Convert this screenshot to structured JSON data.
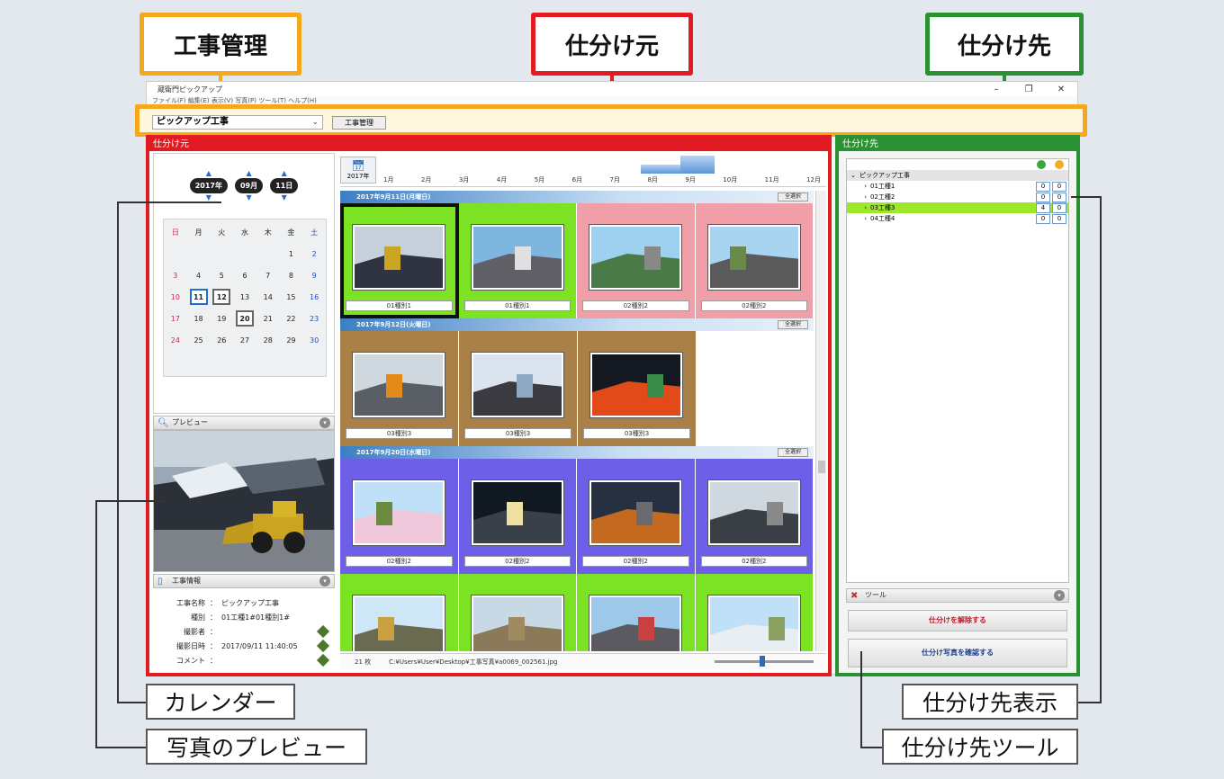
{
  "callouts": {
    "project": "工事管理",
    "source": "仕分け元",
    "dest": "仕分け先",
    "calendar": "カレンダー",
    "preview": "写真のプレビュー",
    "dest_display": "仕分け先表示",
    "dest_tools": "仕分け先ツール"
  },
  "colors": {
    "source": "#e21b23",
    "dest": "#2a9132",
    "project": "#f6a81d"
  },
  "window": {
    "title": "蔵衛門ピックアップ",
    "menu": "ファイル(F)  編集(E)  表示(V)  写真(P)  ツール(T)  ヘルプ(H)"
  },
  "project_bar": {
    "selected": "ピックアップ工事",
    "button": "工事管理"
  },
  "source_panel": {
    "title": "仕分け元"
  },
  "calendar": {
    "year": "2017年",
    "month": "09月",
    "day": "11日",
    "weekdays": [
      "日",
      "月",
      "火",
      "水",
      "木",
      "金",
      "土"
    ],
    "weeks": [
      [
        "",
        "",
        "",
        "",
        "",
        "1",
        "2"
      ],
      [
        "3",
        "4",
        "5",
        "6",
        "7",
        "8",
        "9"
      ],
      [
        "10",
        "11",
        "12",
        "13",
        "14",
        "15",
        "16"
      ],
      [
        "17",
        "18",
        "19",
        "20",
        "21",
        "22",
        "23"
      ],
      [
        "24",
        "25",
        "26",
        "27",
        "28",
        "29",
        "30"
      ]
    ]
  },
  "preview_panel": {
    "title": "プレビュー"
  },
  "info_panel": {
    "title": "工事情報",
    "rows": [
      {
        "k": "工事名称",
        "v": "ピックアップ工事"
      },
      {
        "k": "種別",
        "v": "01工種1#01種別1#"
      },
      {
        "k": "撮影者",
        "v": ""
      },
      {
        "k": "撮影日時",
        "v": "2017/09/11 11:40:05"
      },
      {
        "k": "コメント",
        "v": ""
      }
    ]
  },
  "timeline": {
    "year": "2017年",
    "months": [
      "1月",
      "2月",
      "3月",
      "4月",
      "5月",
      "6月",
      "7月",
      "8月",
      "9月",
      "10月",
      "11月",
      "12月"
    ]
  },
  "days": [
    {
      "header": "2017年9月11日(月曜日)",
      "select_all": "全選択",
      "items": [
        {
          "caption": "01種別1",
          "color": "#7be224",
          "selected": true
        },
        {
          "caption": "01種別1",
          "color": "#7be224"
        },
        {
          "caption": "02種別2",
          "color": "#f09fa8"
        },
        {
          "caption": "02種別2",
          "color": "#f09fa8"
        }
      ]
    },
    {
      "header": "2017年9月12日(火曜日)",
      "select_all": "全選択",
      "items": [
        {
          "caption": "03種別3",
          "color": "#a98048"
        },
        {
          "caption": "03種別3",
          "color": "#a98048"
        },
        {
          "caption": "03種別3",
          "color": "#a98048"
        }
      ]
    },
    {
      "header": "2017年9月20日(水曜日)",
      "select_all": "全選択",
      "items": [
        {
          "caption": "02種別2",
          "color": "#6e5fe8"
        },
        {
          "caption": "02種別2",
          "color": "#6e5fe8"
        },
        {
          "caption": "02種別2",
          "color": "#6e5fe8"
        },
        {
          "caption": "02種別2",
          "color": "#6e5fe8"
        }
      ]
    },
    {
      "header": "",
      "select_all": "",
      "items": [
        {
          "caption": "",
          "color": "#7be224"
        },
        {
          "caption": "",
          "color": "#7be224"
        },
        {
          "caption": "",
          "color": "#7be224"
        },
        {
          "caption": "",
          "color": "#7be224"
        }
      ]
    }
  ],
  "status": {
    "count": "21 枚",
    "path": "C:¥Users¥User¥Desktop¥工事写真¥a0069_002561.jpg"
  },
  "dest_panel": {
    "title": "仕分け先",
    "tree": [
      {
        "label": "ピックアップ工事",
        "root": true,
        "a": "",
        "b": ""
      },
      {
        "label": "01工種1",
        "a": "0",
        "b": "0"
      },
      {
        "label": "02工種2",
        "a": "0",
        "b": "0"
      },
      {
        "label": "03工種3",
        "a": "4",
        "b": "0",
        "highlight": true
      },
      {
        "label": "04工種4",
        "a": "0",
        "b": "0"
      }
    ],
    "tools_title": "ツール",
    "btn_release": "仕分けを解除する",
    "btn_confirm": "仕分け写真を確認する"
  }
}
